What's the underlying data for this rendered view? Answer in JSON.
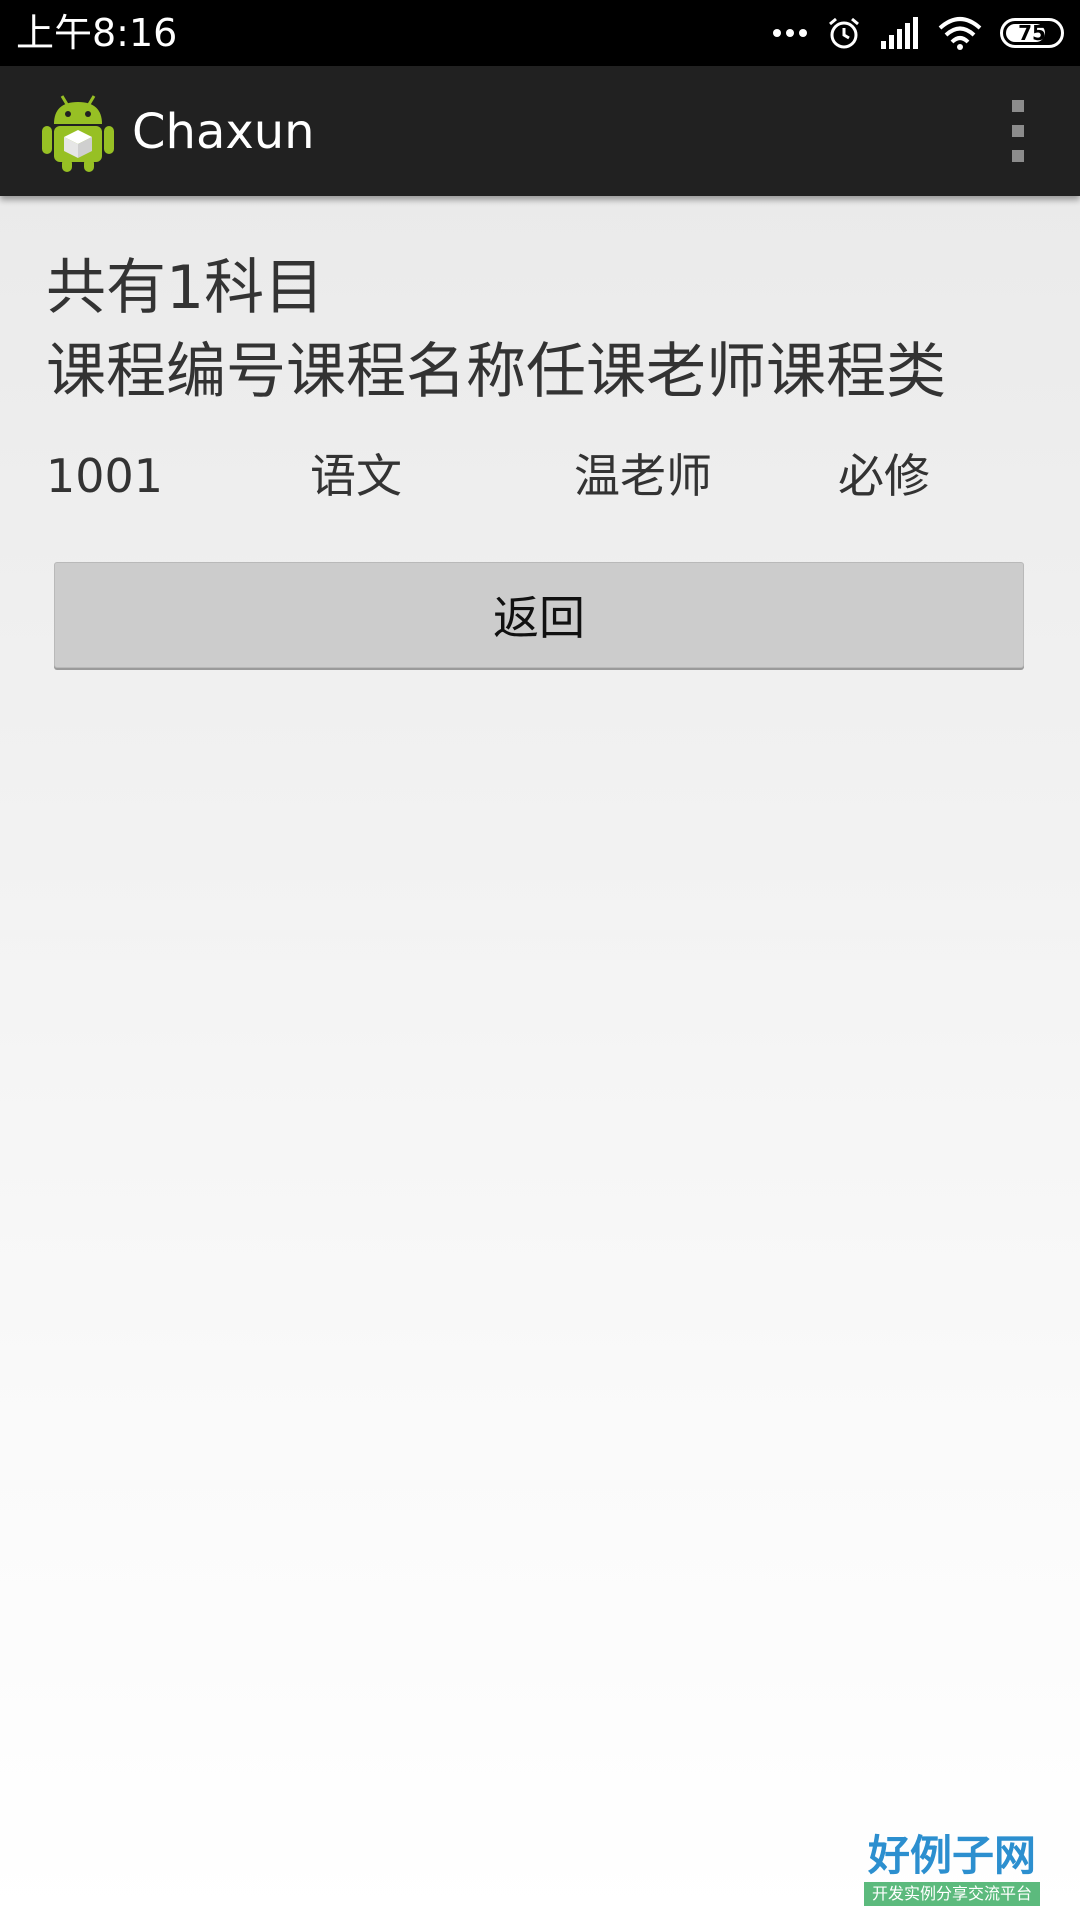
{
  "status_bar": {
    "time": "上午8:16",
    "battery_level": 0.75,
    "battery_label": "75",
    "icons": [
      "more-dots-icon",
      "alarm-icon",
      "signal-icon",
      "wifi-icon",
      "battery-icon"
    ]
  },
  "action_bar": {
    "title": "Chaxun",
    "app_icon": "android-app-icon",
    "menu_icon": "overflow-menu-icon"
  },
  "main": {
    "summary": "共有1科目",
    "header": "课程编号课程名称任课老师课程类",
    "rows": [
      {
        "id": "1001",
        "name": "语文",
        "teacher": "温老师",
        "type": "必修"
      }
    ],
    "back_label": "返回"
  },
  "watermark": {
    "title": "好例子网",
    "subtitle": "开发实例分享交流平台"
  },
  "colors": {
    "status_bar": "#000000",
    "action_bar": "#212121",
    "button": "#cccccc",
    "text": "#333333",
    "android_green": "#97c024"
  }
}
